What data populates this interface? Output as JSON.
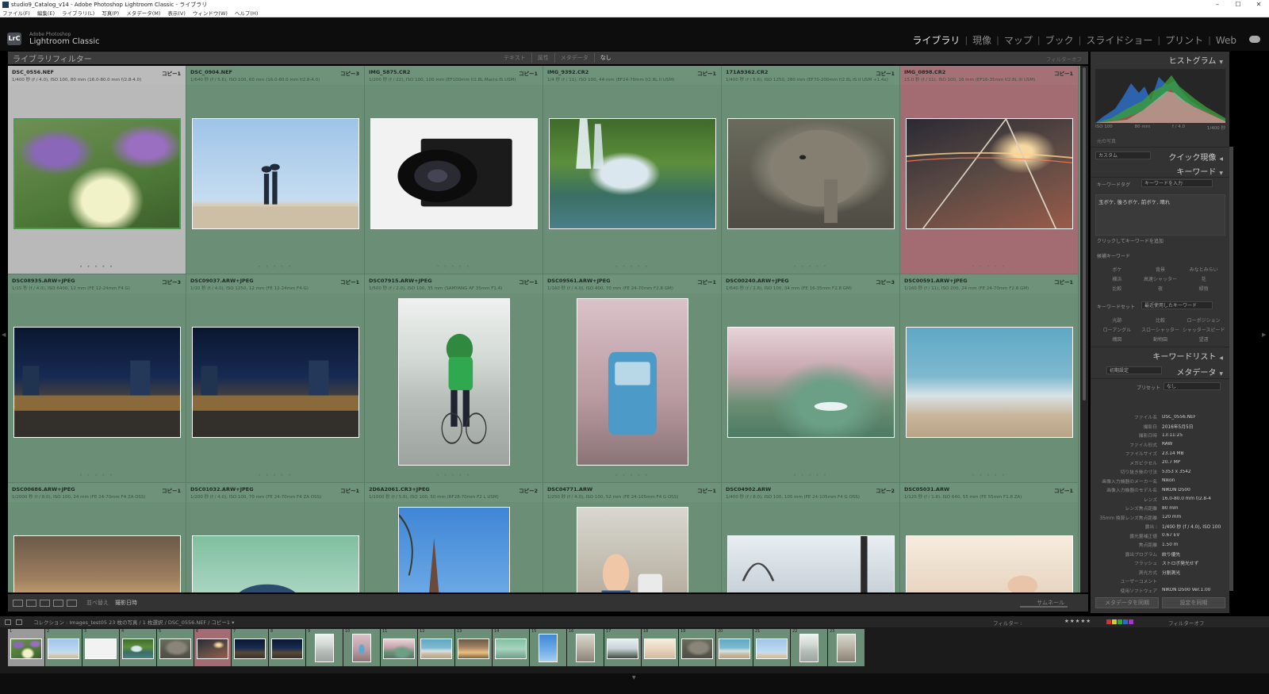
{
  "window": {
    "title": "studio9_Catalog_v14 - Adobe Photoshop Lightroom Classic - ライブラリ",
    "menu": [
      "ファイル(F)",
      "編集(E)",
      "ライブラリ(L)",
      "写真(P)",
      "メタデータ(M)",
      "表示(V)",
      "ウィンドウ(W)",
      "ヘルプ(H)"
    ]
  },
  "brand": {
    "logo": "LrC",
    "line1": "Adobe Photoshop",
    "line2": "Lightroom Classic"
  },
  "modules": [
    {
      "label": "ライブラリ",
      "active": true
    },
    {
      "label": "現像",
      "active": false
    },
    {
      "label": "マップ",
      "active": false
    },
    {
      "label": "ブック",
      "active": false
    },
    {
      "label": "スライドショー",
      "active": false
    },
    {
      "label": "プリント",
      "active": false
    },
    {
      "label": "Web",
      "active": false
    }
  ],
  "filterbar": {
    "title": "ライブラリフィルター",
    "tabs": [
      "テキスト",
      "属性",
      "メタデータ",
      "なし"
    ],
    "active_tab": "なし",
    "filter_off": "フィルターオフ"
  },
  "grid": [
    {
      "name": "DSC_0556.NEF",
      "copy": "コピー1",
      "info": "1/400 秒 (f / 4.0), ISO 100, 80 mm (16.0-80.0 mm f/2.8-4.0)",
      "photo": "flowers",
      "orient": "land",
      "state": "selected"
    },
    {
      "name": "DSC_0904.NEF",
      "copy": "コピー3",
      "info": "1/640 秒 (f / 5.6), ISO 100, 60 mm (16.0-80.0 mm f/2.8-4.0)",
      "photo": "walk",
      "orient": "land",
      "state": ""
    },
    {
      "name": "IMG_5875.CR2",
      "copy": "コピー1",
      "info": "1/200 秒 (f / 22), ISO 100, 100 mm (EF100mm f/2.8L Macro IS USM)",
      "photo": "camera",
      "orient": "land",
      "state": ""
    },
    {
      "name": "IMG_9392.CR2",
      "copy": "コピー1",
      "info": "1/4 秒 (f / 11), ISO 100, 44 mm (EF24-70mm f/2.8L II USM)",
      "photo": "falls",
      "orient": "land",
      "state": ""
    },
    {
      "name": "171A9362.CR2",
      "copy": "コピー1",
      "info": "1/400 秒 (f / 5.6), ISO 1250, 280 mm (EF70-200mm f/2.8L IS II USM +1.4x)",
      "photo": "elephant",
      "orient": "land",
      "state": ""
    },
    {
      "name": "IMG_0898.CR2",
      "copy": "コピー1",
      "info": "15.0 秒 (f / 11), ISO 100, 16 mm (EF16-35mm f/2.8L III USM)",
      "photo": "bridge",
      "orient": "land",
      "state": "red"
    },
    {
      "name": "DSC08935.ARW+JPEG",
      "copy": "コピー3",
      "info": "1/15 秒 (f / 4.0), ISO 6400, 12 mm (FE 12-24mm F4 G)",
      "photo": "night",
      "orient": "land",
      "state": ""
    },
    {
      "name": "DSC09037.ARW+JPEG",
      "copy": "コピー1",
      "info": "1/10 秒 (f / 4.0), ISO 1250, 12 mm (FE 12-24mm F4 G)",
      "photo": "night",
      "orient": "land",
      "state": ""
    },
    {
      "name": "DSC07915.ARW+JPEG",
      "copy": "コピー1",
      "info": "1/500 秒 (f / 2.0), ISO 100, 35 mm (SAMYANG AF 35mm F1.4)",
      "photo": "kid",
      "orient": "port",
      "state": ""
    },
    {
      "name": "DSC09561.ARW+JPEG",
      "copy": "コピー1",
      "info": "1/160 秒 (f / 4.0), ISO 400, 70 mm (FE 24-70mm F2.8 GM)",
      "photo": "car",
      "orient": "port",
      "state": ""
    },
    {
      "name": "DSC00240.ARW+JPEG",
      "copy": "コピー3",
      "info": "1/640 秒 (f / 2.8), ISO 100, 34 mm (FE 16-35mm F2.8 GM)",
      "photo": "boat",
      "orient": "land",
      "state": ""
    },
    {
      "name": "DSC00591.ARW+JPEG",
      "copy": "コピー1",
      "info": "1/160 秒 (f / 11), ISO 200, 24 mm (FE 24-70mm F2.8 GM)",
      "photo": "sea",
      "orient": "land",
      "state": ""
    },
    {
      "name": "DSC00686.ARW+JPEG",
      "copy": "コピー1",
      "info": "1/2000 秒 (f / 8.0), ISO 100, 24 mm (FE 24-70mm F4 ZA OSS)",
      "photo": "sunset",
      "orient": "land",
      "state": ""
    },
    {
      "name": "DSC01032.ARW+JPEG",
      "copy": "コピー1",
      "info": "1/200 秒 (f / 4.0), ISO 100, 70 mm (FE 24-70mm F4 ZA OSS)",
      "photo": "hat",
      "orient": "land",
      "state": ""
    },
    {
      "name": "2D6A2061.CR3+JPEG",
      "copy": "コピー2",
      "info": "1/1000 秒 (f / 5.6), ISO 100, 50 mm (RF28-70mm F2 L USM)",
      "photo": "church",
      "orient": "port",
      "state": ""
    },
    {
      "name": "DSC04771.ARW",
      "copy": "コピー1",
      "info": "1/250 秒 (f / 4.0), ISO 100, 52 mm (FE 24-105mm F4 G OSS)",
      "photo": "hydrant",
      "orient": "port",
      "state": ""
    },
    {
      "name": "DSC04902.ARW",
      "copy": "コピー2",
      "info": "1/400 秒 (f / 8.0), ISO 100, 105 mm (FE 24-105mm F4 G OSS)",
      "photo": "trees",
      "orient": "land",
      "state": ""
    },
    {
      "name": "DSC05031.ARW",
      "copy": "コピー1",
      "info": "1/125 秒 (f / 1.8), ISO 640, 55 mm (FE 55mm F1.8 ZA)",
      "photo": "baby",
      "orient": "land",
      "state": ""
    }
  ],
  "toolbar": {
    "sort_label": "並べ替え",
    "sort_value": "撮影日時",
    "thumbs_label": "サムネール"
  },
  "panel": {
    "histogram": "ヒストグラム",
    "hist_meta": [
      "ISO 100",
      "80 mm",
      "f / 4.0",
      "1/400 秒"
    ],
    "original": "元の写真",
    "custom": "カスタム",
    "quick_develop": "クイック現像",
    "keywording": "キーワード",
    "keyword_tags_label": "キーワードタグ",
    "keyword_tags_select": "キーワードを入力",
    "keywords_text": "玉ボケ, 後ろボケ, 前ボケ, 晴れ",
    "keyword_hint": "クリックしてキーワードを追加",
    "suggested": "候補キーワード",
    "suggested_items": [
      "ボケ",
      "背景",
      "みなとみらい",
      "横浜",
      "高速シャッター",
      "花",
      "比較",
      "夜",
      "緑陰"
    ],
    "keyword_set": "キーワードセット",
    "keyword_set_select": "最近使用したキーワード",
    "keyword_set_items": [
      "光跡",
      "比較",
      "ローポジション",
      "ローアングル",
      "スローシャッター",
      "シャッタースピード",
      "構図",
      "動物園",
      "望遠"
    ],
    "keyword_list": "キーワードリスト",
    "default": "初期設定",
    "metadata": "メタデータ",
    "preset_label": "プリセット",
    "preset_value": "なし",
    "meta": [
      [
        "ファイル名",
        "DSC_0556.NEF"
      ],
      [
        "撮影日",
        "2016年5月5日"
      ],
      [
        "撮影日時",
        "13:11:25"
      ],
      [
        "ファイル形式",
        "RAW"
      ],
      [
        "ファイルサイズ",
        "23.14 MB"
      ],
      [
        "メガピクセル",
        "20.7 MP"
      ],
      [
        "切り抜き後の寸法",
        "5353 x 3542"
      ],
      [
        "画像入力機器のメーカー名",
        "Nikon"
      ],
      [
        "画像入力機器のモデル名",
        "NIKON D500"
      ],
      [
        "レンズ",
        "16.0-80.0 mm f/2.8-4"
      ],
      [
        "レンズ焦点距離",
        "80 mm"
      ],
      [
        "35mm 換算レンズ焦点距離",
        "120 mm"
      ],
      [
        "露出 :",
        "1/400 秒 (f / 4.0), ISO 100"
      ],
      [
        "露光量補正値",
        "0.67 EV"
      ],
      [
        "焦点距離",
        "1.50 m"
      ],
      [
        "露出プログラム",
        "絞り優先"
      ],
      [
        "フラッシュ",
        "ストロボ発光せず"
      ],
      [
        "測光方式",
        "分割測光"
      ],
      [
        "ユーザーコメント",
        ""
      ],
      [
        "使用ソフトウェア",
        "NIKON D500 Ver.1.00"
      ]
    ],
    "btn_sync_meta": "メタデータを同期",
    "btn_sync_settings": "設定を同期"
  },
  "filmstrip_bar": {
    "path": "コレクション : Images_test05   23 枚の写真 / 1 枚選択 / DSC_0556.NEF / コピー1 ▾",
    "filter": "フィルター :",
    "stars": "★★★★★",
    "filter_off": "フィルターオフ"
  },
  "filmstrip": [
    {
      "n": "1",
      "photo": "flowers",
      "o": "l",
      "s": "sel"
    },
    {
      "n": "2",
      "photo": "walk",
      "o": "l",
      "s": ""
    },
    {
      "n": "3",
      "photo": "camera",
      "o": "l",
      "s": ""
    },
    {
      "n": "4",
      "photo": "falls",
      "o": "l",
      "s": ""
    },
    {
      "n": "5",
      "photo": "elephant",
      "o": "l",
      "s": ""
    },
    {
      "n": "6",
      "photo": "bridge",
      "o": "l",
      "s": "red"
    },
    {
      "n": "7",
      "photo": "night",
      "o": "l",
      "s": ""
    },
    {
      "n": "8",
      "photo": "night",
      "o": "l",
      "s": ""
    },
    {
      "n": "9",
      "photo": "kid",
      "o": "p",
      "s": ""
    },
    {
      "n": "10",
      "photo": "car",
      "o": "p",
      "s": ""
    },
    {
      "n": "11",
      "photo": "boat",
      "o": "l",
      "s": ""
    },
    {
      "n": "12",
      "photo": "sea",
      "o": "l",
      "s": ""
    },
    {
      "n": "13",
      "photo": "sunset",
      "o": "l",
      "s": ""
    },
    {
      "n": "14",
      "photo": "hat",
      "o": "l",
      "s": ""
    },
    {
      "n": "15",
      "photo": "church",
      "o": "p",
      "s": ""
    },
    {
      "n": "16",
      "photo": "hydrant",
      "o": "p",
      "s": ""
    },
    {
      "n": "17",
      "photo": "trees",
      "o": "l",
      "s": ""
    },
    {
      "n": "18",
      "photo": "baby",
      "o": "l",
      "s": ""
    },
    {
      "n": "19",
      "photo": "elephant",
      "o": "l",
      "s": ""
    },
    {
      "n": "20",
      "photo": "sea",
      "o": "l",
      "s": ""
    },
    {
      "n": "21",
      "photo": "walk",
      "o": "l",
      "s": ""
    },
    {
      "n": "22",
      "photo": "kid",
      "o": "p",
      "s": ""
    },
    {
      "n": "23",
      "photo": "hydrant",
      "o": "p",
      "s": ""
    }
  ]
}
